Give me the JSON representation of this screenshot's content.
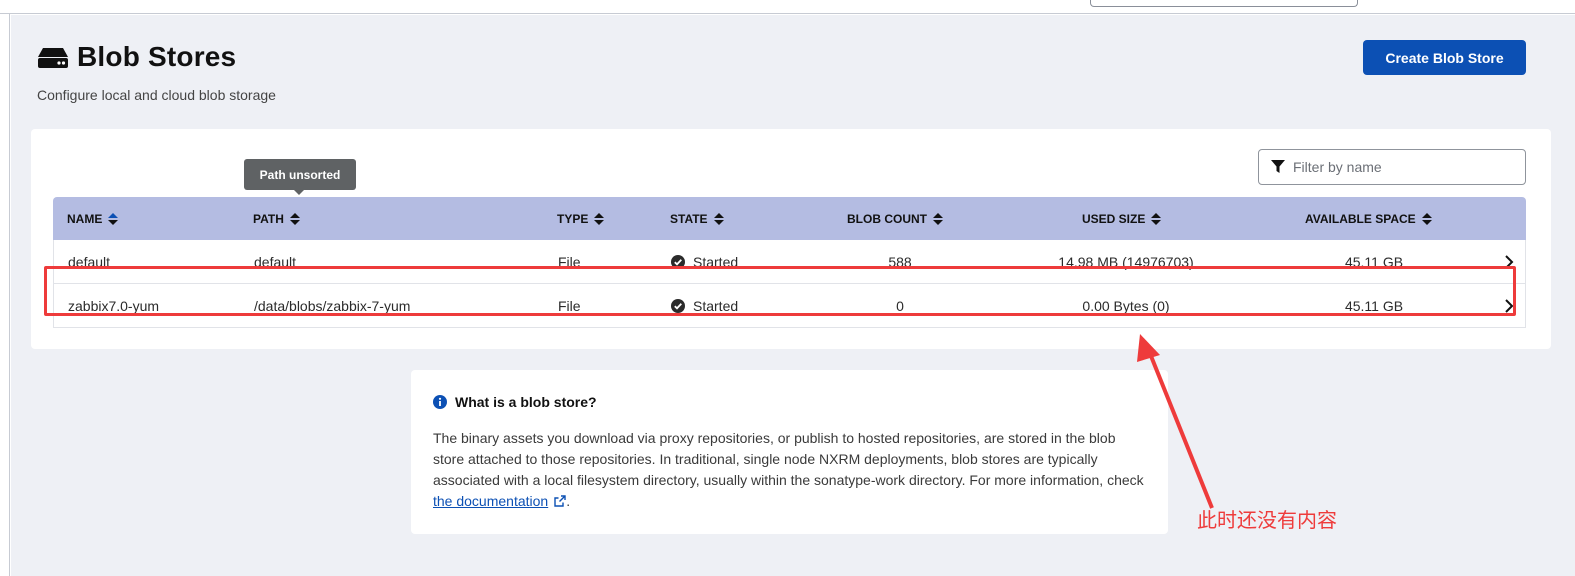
{
  "header": {
    "title": "Blob Stores",
    "subtitle": "Configure local and cloud blob storage",
    "create_button_label": "Create Blob Store",
    "title_icon": "hard-drive-icon"
  },
  "filter": {
    "placeholder": "Filter by name",
    "value": "",
    "icon": "filter-icon"
  },
  "tooltip": {
    "text": "Path unsorted"
  },
  "table": {
    "columns": [
      "NAME",
      "PATH",
      "TYPE",
      "STATE",
      "BLOB COUNT",
      "USED SIZE",
      "AVAILABLE SPACE"
    ],
    "sort_state": {
      "name": "ascending",
      "others": "unsorted"
    },
    "rows": [
      {
        "name": "default",
        "path": "default",
        "type": "File",
        "state": "Started",
        "blob_count": "588",
        "used_size": "14.98 MB (14976703)",
        "available_space": "45.11 GB"
      },
      {
        "name": "zabbix7.0-yum",
        "path": "/data/blobs/zabbix-7-yum",
        "type": "File",
        "state": "Started",
        "blob_count": "0",
        "used_size": "0.00 Bytes (0)",
        "available_space": "45.11 GB"
      }
    ]
  },
  "info": {
    "title": "What is a blob store?",
    "body": "The binary assets you download via proxy repositories, or publish to hosted repositories, are stored in the blob store attached to those repositories. In traditional, single node NXRM deployments, blob stores are typically associated with a local filesystem directory, usually within the sonatype-work directory. For more information, check ",
    "link_text": "the documentation",
    "trailing": "."
  },
  "annotation": {
    "text": "此时还没有内容",
    "color": "#ee3b3b"
  },
  "colors": {
    "primary": "#0c50b4",
    "table_header": "#b4bce2",
    "page_bg": "#eef0f5"
  }
}
